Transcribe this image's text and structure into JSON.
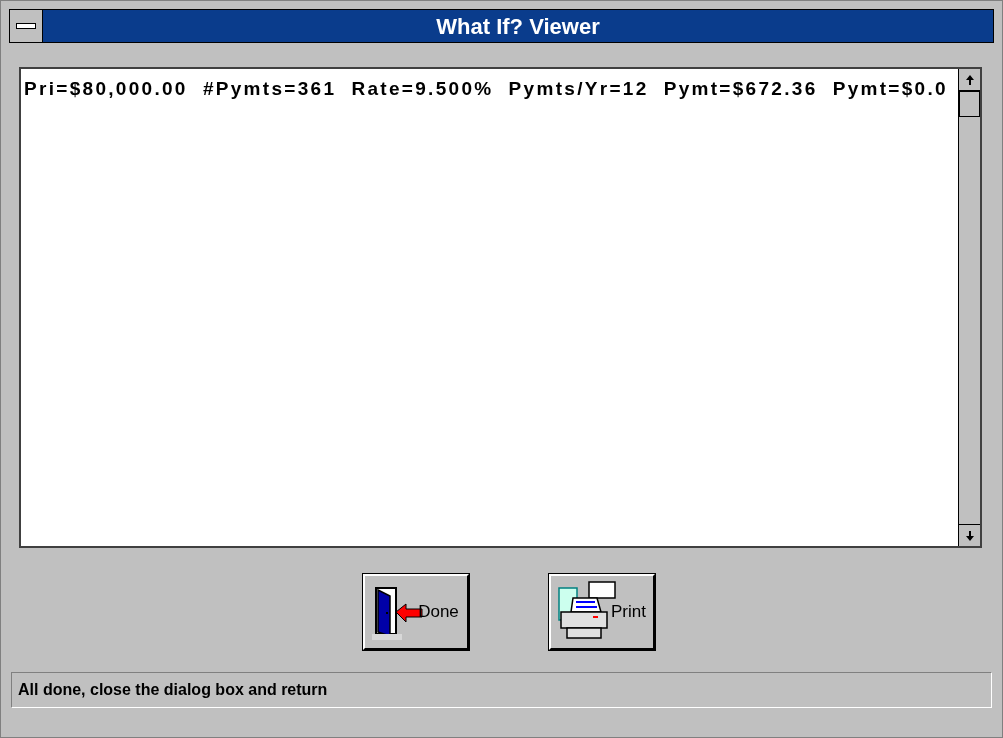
{
  "window": {
    "title": "What If? Viewer"
  },
  "viewer": {
    "line": "Pri=$80,000.00  #Pymts=361  Rate=9.500%  Pymts/Yr=12  Pymt=$672.36  Pymt=$0.0"
  },
  "buttons": [
    {
      "kind": "done",
      "label": "Done"
    },
    {
      "kind": "print",
      "label": "Print"
    }
  ],
  "status_bar": "All done, close the dialog box and return"
}
